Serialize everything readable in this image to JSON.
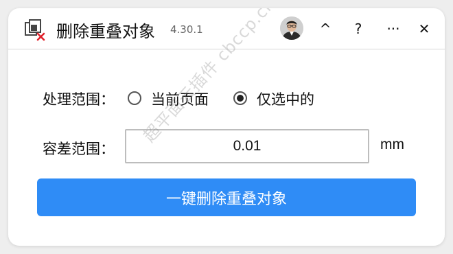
{
  "app": {
    "title": "删除重叠对象",
    "version": "4.30.1"
  },
  "titlebar": {
    "collapse_label": "^",
    "help_label": "?",
    "more_label": "···",
    "close_label": "✕"
  },
  "range": {
    "label": "处理范围：",
    "options": [
      {
        "label": "当前页面",
        "selected": false
      },
      {
        "label": "仅选中的",
        "selected": true
      }
    ]
  },
  "tolerance": {
    "label": "容差范围：",
    "value": "0.01",
    "unit": "mm"
  },
  "action": {
    "label": "一键删除重叠对象"
  },
  "watermark": "超平面云插件 cbccp.cn",
  "colors": {
    "primary_button": "#2f8cf6",
    "icon_red": "#e0202a"
  }
}
